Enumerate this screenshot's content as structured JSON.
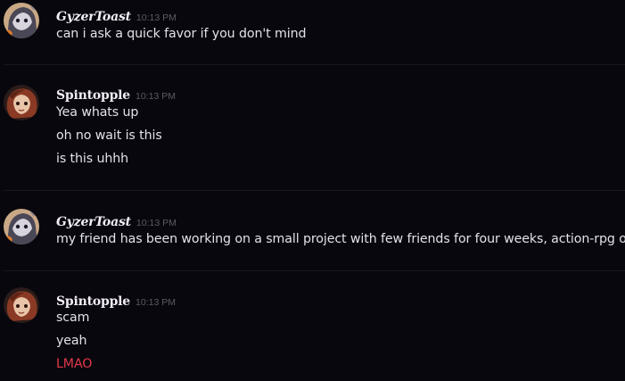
{
  "messages": [
    {
      "username": "GyzerToast",
      "timestamp": "10:13 PM",
      "lines": [
        {
          "text": "can i ask a quick favor if you don't mind",
          "color": "#e3e1ea"
        }
      ]
    },
    {
      "username": "Spintopple",
      "timestamp": "10:13 PM",
      "lines": [
        {
          "text": "Yea whats up",
          "color": "#e3e1ea"
        },
        {
          "text": "oh no wait is this",
          "color": "#e3e1ea"
        },
        {
          "text": "is this uhhh",
          "color": "#e3e1ea"
        }
      ]
    },
    {
      "username": "GyzerToast",
      "timestamp": "10:13 PM",
      "lines": [
        {
          "text": "my friend has been working on a small project with few friends for four weeks, action-rpg one",
          "color": "#e3e1ea"
        }
      ]
    },
    {
      "username": "Spintopple",
      "timestamp": "10:13 PM",
      "lines": [
        {
          "text": "scam",
          "color": "#e3e1ea"
        },
        {
          "text": "yeah",
          "color": "#e3e1ea"
        },
        {
          "text": "LMAO",
          "color": "#e2394a"
        }
      ]
    }
  ],
  "colors": {
    "background": "#08070d",
    "username": "#f2edf7",
    "timestamp": "#5d5a66",
    "message_text": "#e3e1ea",
    "highlight_red": "#e2394a"
  }
}
